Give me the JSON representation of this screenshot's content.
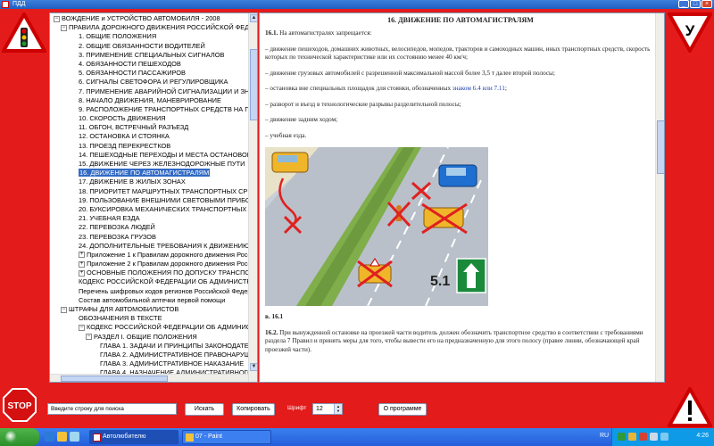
{
  "window": {
    "title": "ПДД"
  },
  "tree": {
    "items": [
      {
        "label": "ВОЖДЕНИЕ и УСТРОЙСТВО АВТОМОБИЛЯ - 2008",
        "level": 0,
        "expander": "−"
      },
      {
        "label": "ПРАВИЛА  ДОРОЖНОГО ДВИЖЕНИЯ РОССИЙСКОЙ ФЕДЕ",
        "level": 1,
        "expander": "−"
      },
      {
        "label": "1. ОБЩИЕ ПОЛОЖЕНИЯ",
        "level": 2
      },
      {
        "label": "2. ОБЩИЕ ОБЯЗАННОСТИ ВОДИТЕЛЕЙ",
        "level": 2
      },
      {
        "label": "3. ПРИМЕНЕНИЕ СПЕЦИАЛЬНЫХ СИГНАЛОВ",
        "level": 2
      },
      {
        "label": "4. ОБЯЗАННОСТИ ПЕШЕХОДОВ",
        "level": 2
      },
      {
        "label": "5. ОБЯЗАННОСТИ ПАССАЖИРОВ",
        "level": 2
      },
      {
        "label": "6. СИГНАЛЫ СВЕТОФОРА И РЕГУЛИРОВЩИКА",
        "level": 2
      },
      {
        "label": "7. ПРИМЕНЕНИЕ АВАРИЙНОЙ СИГНАЛИЗАЦИИ  И  ЗНА",
        "level": 2
      },
      {
        "label": "8. НАЧАЛО ДВИЖЕНИЯ, МАНЕВРИРОВАНИЕ",
        "level": 2
      },
      {
        "label": "9. РАСПОЛОЖЕНИЕ ТРАНСПОРТНЫХ СРЕДСТВ  НА ПР",
        "level": 2
      },
      {
        "label": "10. СКОРОСТЬ ДВИЖЕНИЯ",
        "level": 2
      },
      {
        "label": "11. ОБГОН, ВСТРЕЧНЫЙ РАЗЪЕЗД",
        "level": 2
      },
      {
        "label": "12. ОСТАНОВКА И СТОЯНКА",
        "level": 2
      },
      {
        "label": "13. ПРОЕЗД ПЕРЕКРЕСТКОВ",
        "level": 2
      },
      {
        "label": "14. ПЕШЕХОДНЫЕ ПЕРЕХОДЫ И МЕСТА ОСТАНОВОК",
        "level": 2
      },
      {
        "label": "15. ДВИЖЕНИЕ ЧЕРЕЗ ЖЕЛЕЗНОДОРОЖНЫЕ ПУТИ",
        "level": 2
      },
      {
        "label": "16. ДВИЖЕНИЕ ПО АВТОМАГИСТРАЛЯМ",
        "level": 2,
        "selected": true
      },
      {
        "label": "17. ДВИЖЕНИЕ В ЖИЛЫХ ЗОНАХ",
        "level": 2
      },
      {
        "label": "18. ПРИОРИТЕТ МАРШРУТНЫХ ТРАНСПОРТНЫХ СРЕД",
        "level": 2
      },
      {
        "label": "19. ПОЛЬЗОВАНИЕ ВНЕШНИМИ СВЕТОВЫМИ ПРИБОРА",
        "level": 2
      },
      {
        "label": "20. БУКСИРОВКА МЕХАНИЧЕСКИХ ТРАНСПОРТНЫХ СРЕ",
        "level": 2
      },
      {
        "label": "21. УЧЕБНАЯ ЕЗДА",
        "level": 2
      },
      {
        "label": "22. ПЕРЕВОЗКА ЛЮДЕЙ",
        "level": 2
      },
      {
        "label": "23. ПЕРЕВОЗКА ГРУЗОВ",
        "level": 2
      },
      {
        "label": "24. ДОПОЛНИТЕЛЬНЫЕ ТРЕБОВАНИЯ К ДВИЖЕНИЮ",
        "level": 2
      },
      {
        "label": "Приложение 1  к Правилам дорожного движения  Российск",
        "level": 2,
        "expander": "+"
      },
      {
        "label": "Приложение 2  к Правилам дорожного движения  Российс",
        "level": 2,
        "expander": "+"
      },
      {
        "label": "ОСНОВНЫЕ ПОЛОЖЕНИЯ  ПО ДОПУСКУ ТРАНСПОРТ",
        "level": 2,
        "expander": "+"
      },
      {
        "label": "КОДЕКС РОССИЙСКОЙ ФЕДЕРАЦИИ  ОБ АДМИНИСТР",
        "level": 2
      },
      {
        "label": "Перечень  шифровых кодов регионов Российской Федера",
        "level": 2
      },
      {
        "label": "Состав  автомобильной аптечки первой помощи",
        "level": 2
      },
      {
        "label": "ШТРАФЫ ДЛЯ АВТОМОБИЛИСТОВ",
        "level": 1,
        "expander": "−"
      },
      {
        "label": "ОБОЗНАЧЕНИЯ В ТЕКСТЕ",
        "level": 2
      },
      {
        "label": "КОДЕКС РОССИЙСКОЙ ФЕДЕРАЦИИ  ОБ АДМИНИСТ",
        "level": 2,
        "expander": "−"
      },
      {
        "label": "РАЗДЕЛ I. ОБЩИЕ ПОЛОЖЕНИЯ",
        "level": 3,
        "expander": "−"
      },
      {
        "label": "ГЛАВА 1. ЗАДАЧИ И ПРИНЦИПЫ ЗАКОНОДАТЕ",
        "level": 4
      },
      {
        "label": "ГЛАВА 2. АДМИНИСТРАТИВНОЕ ПРАВОНАРУШ",
        "level": 4
      },
      {
        "label": "ГЛАВА 3. АДМИНИСТРАТИВНОЕ НАКАЗАНИЕ",
        "level": 4
      },
      {
        "label": "ГЛАВА 4. НАЗНАЧЕНИЕ АДМИНИСТРАТИВНОГО",
        "level": 4
      },
      {
        "label": "РАЗДЕЛ II. ОСОБЕННАЯ ЧАСТЬ",
        "level": 3,
        "expander": "−"
      }
    ]
  },
  "content": {
    "title": "16. ДВИЖЕНИЕ ПО АВТОМАГИСТРАЛЯМ",
    "intro_num": "16.1.",
    "intro_text": " На автомагистралях запрещается:",
    "bullets": [
      "– движение пешеходов, домашних животных, велосипедов, мопедов, тракторов и самоходных машин, иных транспортных средств, скорость которых по технической характеристике или их состоянию менее 40 км/ч;",
      "– движение грузовых автомобилей с разрешенной максимальной массой более 3,5 т далее второй полосы;",
      "– разворот и въезд в технологические разрывы разделительной полосы;",
      "– движение задним ходом;",
      "– учебная езда."
    ],
    "stop_before": "– остановка вне специальных площадок для стоянки, обозначенных ",
    "stop_link": "знаком 6.4 или 7.11",
    "stop_after": ";",
    "figure_caption": "в. 16.1",
    "sign_label": "5.1",
    "para2_num": "16.2.",
    "para2_text": " При вынужденной остановке на проезжей части водитель должен обозначить транспортное средство в соответствии с требованиями раздела 7 Правил и принять меры для того, чтобы вывести его на предназначенную для этого полосу (правее линии, обозначающей край проезжей части)."
  },
  "signs": {
    "top_right_letter": "У",
    "stop_text": "STOP"
  },
  "toolbar": {
    "search_value": "Введите строку для поиска",
    "search_button": "Искать",
    "copy_button": "Копировать",
    "font_label": "Шрифт",
    "font_size": "12",
    "about_button": "О программе"
  },
  "taskbar": {
    "tasks": [
      {
        "label": "Автолюбителю",
        "active": true
      },
      {
        "label": "07 - Paint",
        "active": false
      }
    ],
    "lang": "RU",
    "time": "4:26"
  },
  "colors": {
    "frame_red": "#e31b1b",
    "selection": "#316ac5",
    "link": "#1a3fb0",
    "taskbar": "#245edb"
  }
}
